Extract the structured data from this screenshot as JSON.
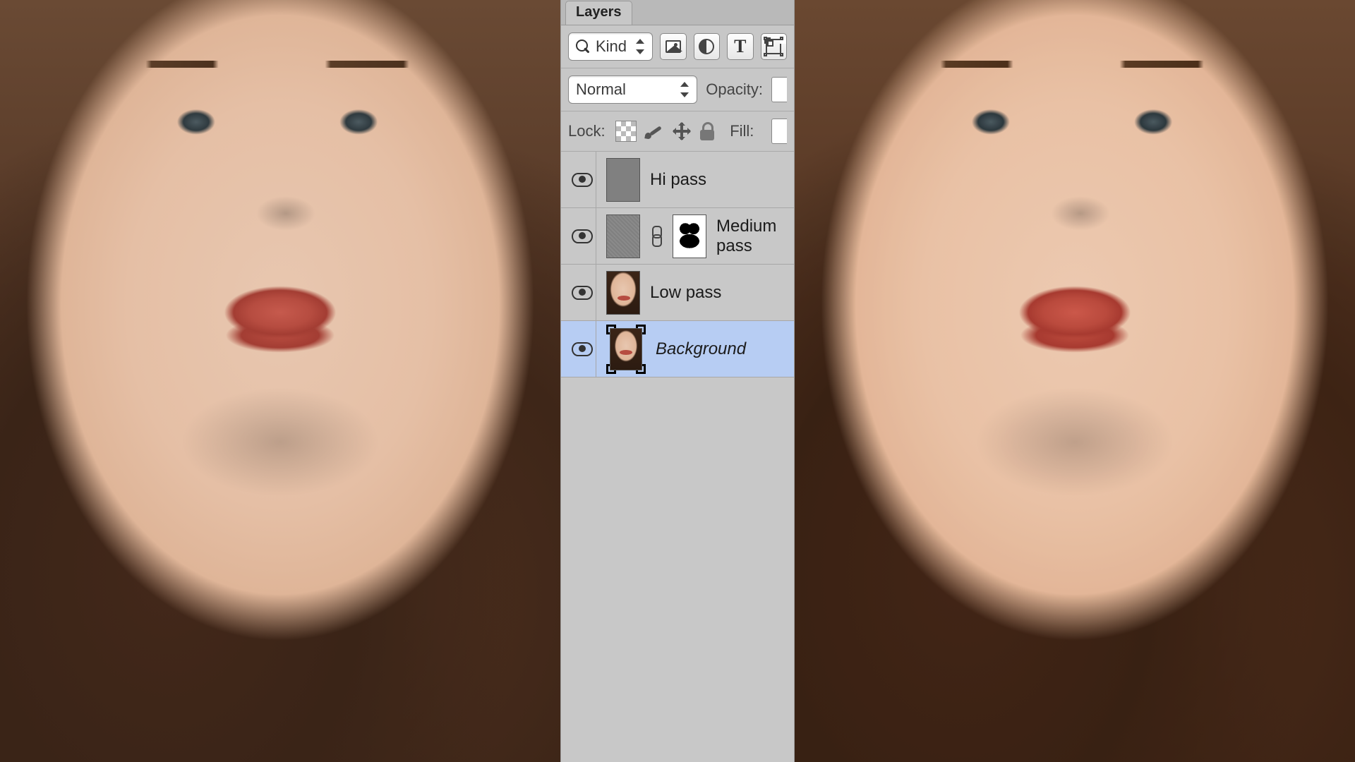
{
  "panel": {
    "tab_label": "Layers",
    "filter": {
      "search_value": "Kind",
      "icons": [
        "image-filter-icon",
        "adjustment-filter-icon",
        "type-filter-icon",
        "shape-filter-icon"
      ]
    },
    "blend": {
      "mode": "Normal",
      "opacity_label": "Opacity:"
    },
    "lock": {
      "label": "Lock:",
      "fill_label": "Fill:"
    },
    "layers": [
      {
        "name": "Hi pass",
        "thumb": "gray",
        "has_mask": false,
        "selected": false,
        "italic": false
      },
      {
        "name": "Medium pass",
        "thumb": "gray-noise",
        "has_mask": true,
        "selected": false,
        "italic": false
      },
      {
        "name": "Low pass",
        "thumb": "face",
        "has_mask": false,
        "selected": false,
        "italic": false
      },
      {
        "name": "Background",
        "thumb": "face-bg",
        "has_mask": false,
        "selected": true,
        "italic": true
      }
    ]
  }
}
